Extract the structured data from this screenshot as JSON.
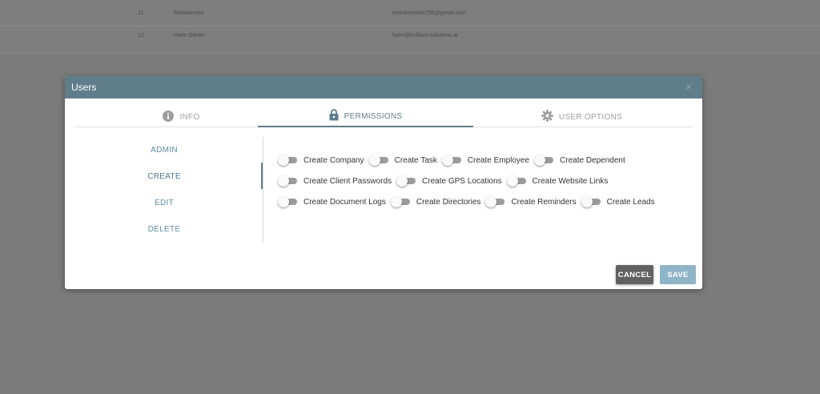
{
  "background_table": {
    "rows": [
      {
        "num": "11",
        "name": "Mohammad",
        "email": "mohammad4756@gmail.com"
      },
      {
        "num": "12",
        "name": "Haim Daniel",
        "email": "haim@brilliant-solutions.ai"
      }
    ]
  },
  "modal": {
    "title": "Users",
    "close_glyph": "×",
    "tabs": [
      {
        "label": "INFO",
        "icon": "info-icon"
      },
      {
        "label": "PERMISSIONS",
        "icon": "lock-icon",
        "active": true
      },
      {
        "label": "USER OPTIONS",
        "icon": "gear-icon"
      }
    ],
    "sidenav": [
      {
        "label": "ADMIN"
      },
      {
        "label": "CREATE",
        "active": true
      },
      {
        "label": "EDIT"
      },
      {
        "label": "DELETE"
      }
    ],
    "permissions": [
      [
        "Create Company",
        "Create Task",
        "Create Employee",
        "Create Dependent"
      ],
      [
        "Create Client Passwords",
        "Create GPS Locations",
        "Create Website Links"
      ],
      [
        "Create Document Logs",
        "Create Directories",
        "Create Reminders",
        "Create Leads"
      ]
    ],
    "buttons": {
      "cancel": "CANCEL",
      "save": "SAVE"
    }
  },
  "colors": {
    "header": "#607d8b",
    "accent": "#607d8b",
    "overlay": "#7b7b7b",
    "save": "#90b4c7",
    "cancel": "#616161"
  }
}
